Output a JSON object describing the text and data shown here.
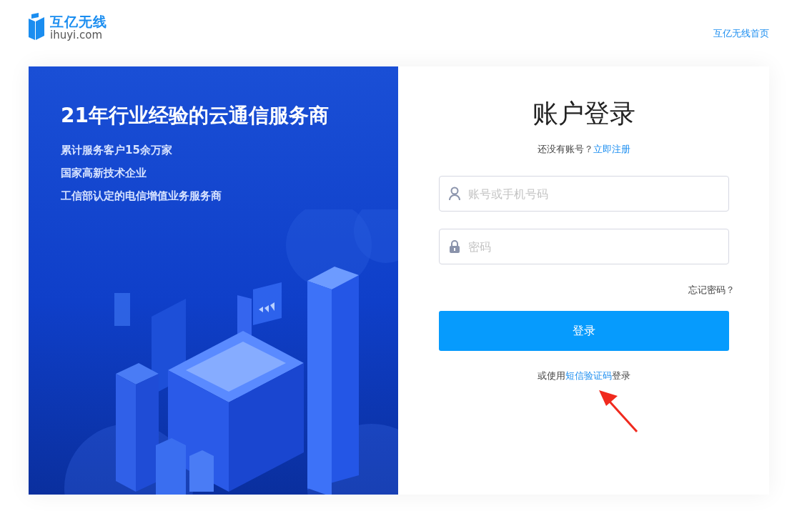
{
  "header": {
    "logo_text": "互亿无线",
    "logo_domain": "ihuyi.com",
    "home_link": "互亿无线首页"
  },
  "promo": {
    "headline": "21年行业经验的云通信服务商",
    "points": [
      "累计服务客户15余万家",
      "国家高新技术企业",
      "工信部认定的电信增值业务服务商"
    ]
  },
  "login": {
    "title": "账户登录",
    "register_prompt": {
      "text": "还没有账号？",
      "link": "立即注册"
    },
    "fields": [
      {
        "kind": "user",
        "placeholder": "账号或手机号码"
      },
      {
        "kind": "password",
        "placeholder": "密码"
      }
    ],
    "forgot_link": "忘记密码？",
    "submit": "登录",
    "sms_prompt": {
      "prefix": "或使用",
      "link": "短信验证码",
      "suffix": "登录"
    }
  }
}
